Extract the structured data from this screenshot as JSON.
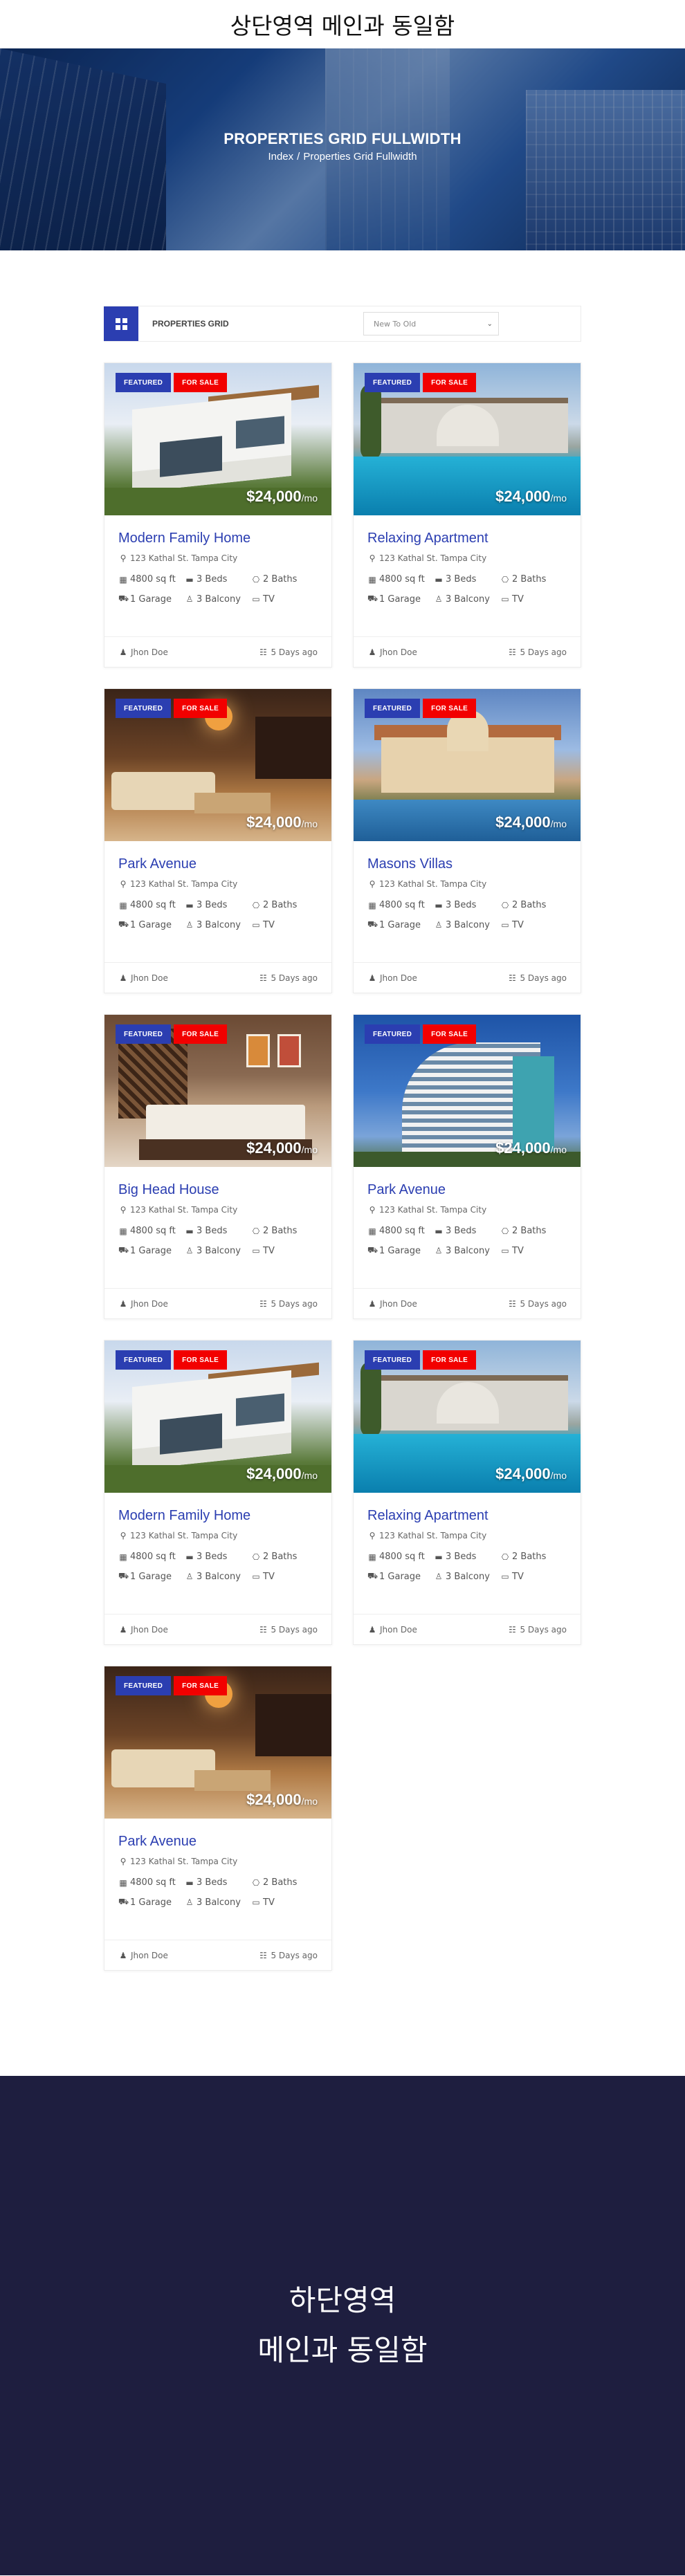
{
  "top_note": "상단영역 메인과 동일함",
  "hero": {
    "title": "PROPERTIES GRID FULLWIDTH",
    "breadcrumb_home": "Index",
    "breadcrumb_sep": "/",
    "breadcrumb_current": "Properties Grid Fullwidth"
  },
  "toolbar": {
    "label": "PROPERTIES GRID",
    "sort_value": "New To Old"
  },
  "icons": {
    "grid_view": "grid-icon",
    "location": "map-marker-icon",
    "area": "area-icon",
    "beds": "bed-icon",
    "baths": "bath-icon",
    "garage": "car-icon",
    "balcony": "balcony-icon",
    "tv": "tv-icon",
    "user": "user-icon",
    "calendar": "calendar-icon"
  },
  "colors": {
    "accent": "#2b3eb1",
    "sale": "#f20000",
    "footer_bg": "#1e1e3f"
  },
  "properties": [
    {
      "title": "Modern Family Home",
      "image": "villa",
      "badge_featured": "FEATURED",
      "badge_sale": "FOR SALE",
      "price": "$24,000",
      "price_unit": "/mo",
      "address": "123 Kathal St. Tampa City",
      "area": "4800 sq ft",
      "beds": "3 Beds",
      "baths": "2 Baths",
      "garage": "1 Garage",
      "balcony": "3 Balcony",
      "tv": "TV",
      "agent": "Jhon Doe",
      "posted": "5 Days ago"
    },
    {
      "title": "Relaxing Apartment",
      "image": "pool",
      "badge_featured": "FEATURED",
      "badge_sale": "FOR SALE",
      "price": "$24,000",
      "price_unit": "/mo",
      "address": "123 Kathal St. Tampa City",
      "area": "4800 sq ft",
      "beds": "3 Beds",
      "baths": "2 Baths",
      "garage": "1 Garage",
      "balcony": "3 Balcony",
      "tv": "TV",
      "agent": "Jhon Doe",
      "posted": "5 Days ago"
    },
    {
      "title": "Park Avenue",
      "image": "interior",
      "badge_featured": "FEATURED",
      "badge_sale": "FOR SALE",
      "price": "$24,000",
      "price_unit": "/mo",
      "address": "123 Kathal St. Tampa City",
      "area": "4800 sq ft",
      "beds": "3 Beds",
      "baths": "2 Baths",
      "garage": "1 Garage",
      "balcony": "3 Balcony",
      "tv": "TV",
      "agent": "Jhon Doe",
      "posted": "5 Days ago"
    },
    {
      "title": "Masons Villas",
      "image": "mansion",
      "badge_featured": "FEATURED",
      "badge_sale": "FOR SALE",
      "price": "$24,000",
      "price_unit": "/mo",
      "address": "123 Kathal St. Tampa City",
      "area": "4800 sq ft",
      "beds": "3 Beds",
      "baths": "2 Baths",
      "garage": "1 Garage",
      "balcony": "3 Balcony",
      "tv": "TV",
      "agent": "Jhon Doe",
      "posted": "5 Days ago"
    },
    {
      "title": "Big Head House",
      "image": "bedroom",
      "badge_featured": "FEATURED",
      "badge_sale": "FOR SALE",
      "price": "$24,000",
      "price_unit": "/mo",
      "address": "123 Kathal St. Tampa City",
      "area": "4800 sq ft",
      "beds": "3 Beds",
      "baths": "2 Baths",
      "garage": "1 Garage",
      "balcony": "3 Balcony",
      "tv": "TV",
      "agent": "Jhon Doe",
      "posted": "5 Days ago"
    },
    {
      "title": "Park Avenue",
      "image": "hotel",
      "badge_featured": "FEATURED",
      "badge_sale": "FOR SALE",
      "price": "$24,000",
      "price_unit": "/mo",
      "address": "123 Kathal St. Tampa City",
      "area": "4800 sq ft",
      "beds": "3 Beds",
      "baths": "2 Baths",
      "garage": "1 Garage",
      "balcony": "3 Balcony",
      "tv": "TV",
      "agent": "Jhon Doe",
      "posted": "5 Days ago"
    },
    {
      "title": "Modern Family Home",
      "image": "villa",
      "badge_featured": "FEATURED",
      "badge_sale": "FOR SALE",
      "price": "$24,000",
      "price_unit": "/mo",
      "address": "123 Kathal St. Tampa City",
      "area": "4800 sq ft",
      "beds": "3 Beds",
      "baths": "2 Baths",
      "garage": "1 Garage",
      "balcony": "3 Balcony",
      "tv": "TV",
      "agent": "Jhon Doe",
      "posted": "5 Days ago"
    },
    {
      "title": "Relaxing Apartment",
      "image": "pool",
      "badge_featured": "FEATURED",
      "badge_sale": "FOR SALE",
      "price": "$24,000",
      "price_unit": "/mo",
      "address": "123 Kathal St. Tampa City",
      "area": "4800 sq ft",
      "beds": "3 Beds",
      "baths": "2 Baths",
      "garage": "1 Garage",
      "balcony": "3 Balcony",
      "tv": "TV",
      "agent": "Jhon Doe",
      "posted": "5 Days ago"
    },
    {
      "title": "Park Avenue",
      "image": "interior",
      "badge_featured": "FEATURED",
      "badge_sale": "FOR SALE",
      "price": "$24,000",
      "price_unit": "/mo",
      "address": "123 Kathal St. Tampa City",
      "area": "4800 sq ft",
      "beds": "3 Beds",
      "baths": "2 Baths",
      "garage": "1 Garage",
      "balcony": "3 Balcony",
      "tv": "TV",
      "agent": "Jhon Doe",
      "posted": "5 Days ago"
    }
  ],
  "footer": {
    "line1": "하단영역",
    "line2": "메인과 동일함"
  }
}
